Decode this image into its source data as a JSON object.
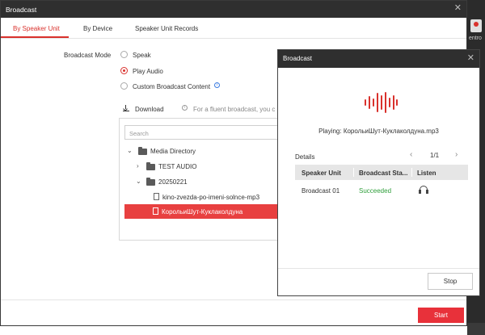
{
  "window": {
    "title": "Broadcast"
  },
  "tabs": [
    {
      "label": "By Speaker Unit",
      "active": true
    },
    {
      "label": "By Device",
      "active": false
    },
    {
      "label": "Speaker Unit Records",
      "active": false
    }
  ],
  "mode": {
    "label": "Broadcast Mode",
    "options": [
      {
        "label": "Speak",
        "selected": false
      },
      {
        "label": "Play Audio",
        "selected": true
      },
      {
        "label": "Custom Broadcast Content",
        "selected": false
      }
    ]
  },
  "download": {
    "label": "Download",
    "hint": "For a fluent broadcast, you c"
  },
  "tree": {
    "search_placeholder": "Search",
    "root": "Media Directory",
    "folder1": "TEST AUDIO",
    "folder2": "20250221",
    "file1": "kino-zvezda-po-imeni-solnce-mp3",
    "file2": "КорольиШут-Куклаколдуна"
  },
  "start_label": "Start",
  "background": {
    "text": "entro"
  },
  "popup": {
    "title": "Broadcast",
    "playing": "Playing: КорольиШут-Куклаколдуна.mp3",
    "details_label": "Details",
    "page": "1/1",
    "columns": [
      "Speaker Unit",
      "Broadcast Sta...",
      "Listen"
    ],
    "rows": [
      {
        "speaker_unit": "Broadcast 01",
        "status": "Succeeded"
      }
    ],
    "stop_label": "Stop"
  },
  "colors": {
    "accent": "#d9312c",
    "success": "#2e9e3a",
    "titlebar": "#2f2f2f"
  },
  "icons": [
    "close-icon",
    "info-icon",
    "download-icon",
    "folder-icon",
    "file-icon",
    "chevron-right-icon",
    "chevron-down-icon",
    "sound-wave-icon",
    "headset-icon",
    "chevron-left-icon"
  ]
}
